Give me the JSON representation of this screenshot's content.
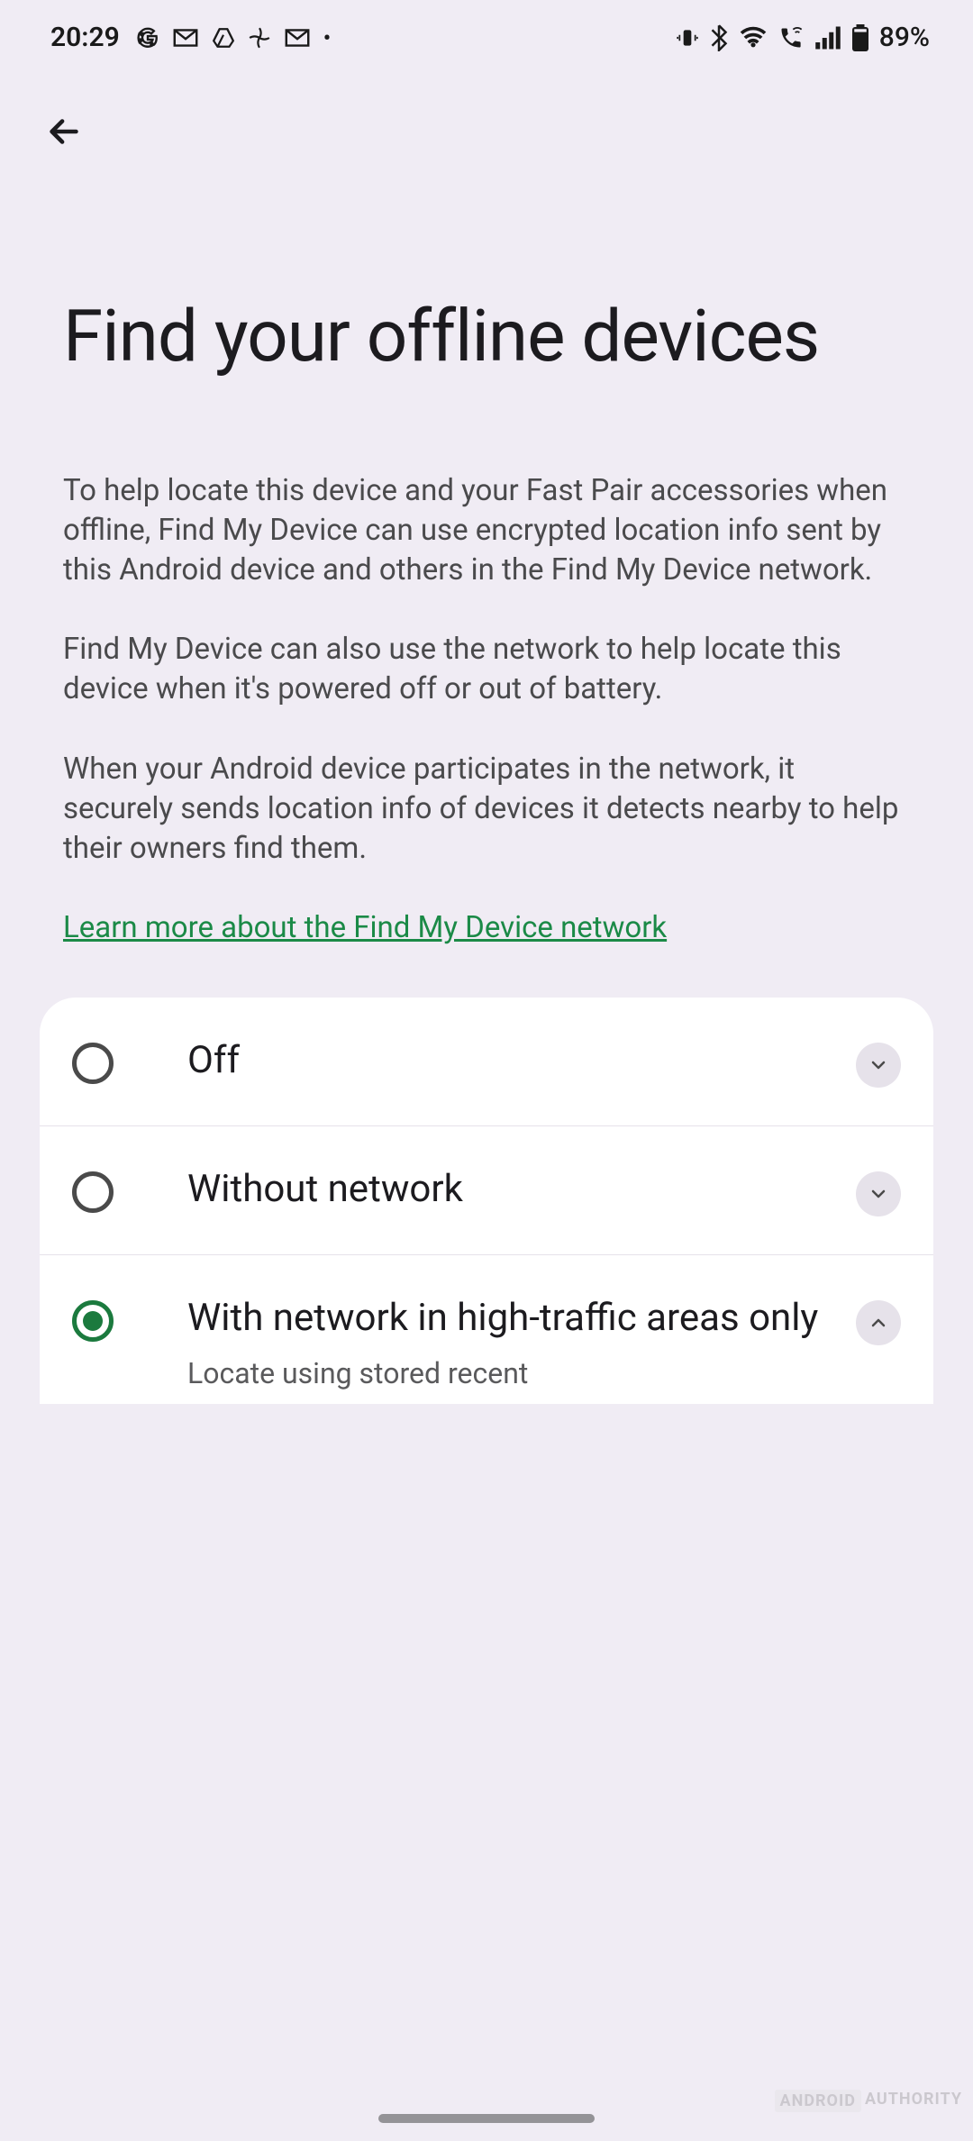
{
  "status": {
    "time": "20:29",
    "battery_percent": "89%"
  },
  "page": {
    "title": "Find your offline devices",
    "description_p1": "To help locate this device and your Fast Pair accessories when offline, Find My Device can use encrypted location info sent by this Android device and others in the Find My Device network.",
    "description_p2": "Find My Device can also use the network to help locate this device when it's powered off or out of battery.",
    "description_p3": "When your Android device participates in the network, it securely sends location info of devices it detects nearby to help their owners find them.",
    "learn_more_label": "Learn more about the Find My Device network"
  },
  "options": {
    "off": {
      "label": "Off",
      "selected": false,
      "expanded": false
    },
    "without_network": {
      "label": "Without network",
      "selected": false,
      "expanded": false
    },
    "high_traffic": {
      "label": "With network in high-traffic areas only",
      "sub": "Locate using stored recent",
      "selected": true,
      "expanded": true
    }
  },
  "watermark": {
    "part1": "ANDROID",
    "part2": "AUTHORITY"
  }
}
